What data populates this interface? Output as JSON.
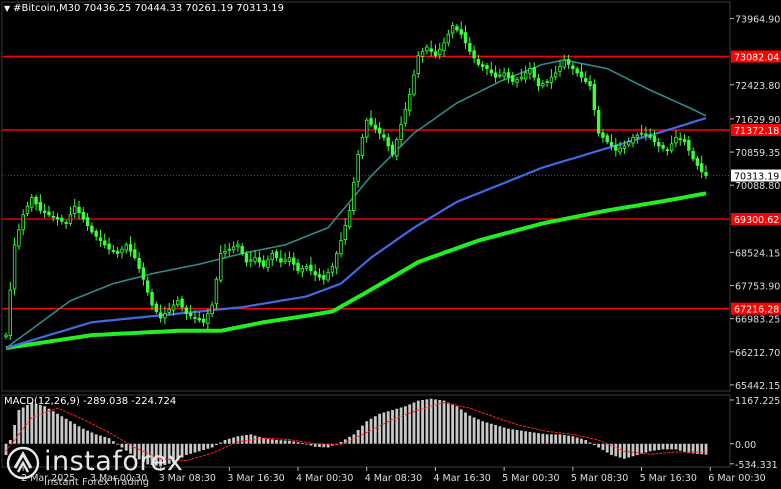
{
  "header": {
    "symbol": "#Bitcoin,M30",
    "open": "70436.25",
    "high": "70444.33",
    "low": "70261.19",
    "close": "70313.19"
  },
  "macd": {
    "label": "MACD(12,26,9)",
    "main": "-289.038",
    "signal": "-224.724"
  },
  "logo": {
    "name": "instaforex",
    "tagline": "Instant Forex Trading"
  },
  "chart_data": {
    "type": "candlestick",
    "symbol": "#Bitcoin",
    "timeframe": "M30",
    "price_axis_ticks": [
      73964.9,
      73082.04,
      72423.8,
      71629.9,
      71372.18,
      70859.35,
      70313.19,
      70088.8,
      69300.62,
      68524.15,
      67753.9,
      67216.28,
      66983.25,
      66212.7,
      65442.15
    ],
    "price_ylim": [
      65300,
      74350
    ],
    "horizontal_levels": [
      {
        "price": 73082.04,
        "label": "73082.04",
        "color": "#ff0000"
      },
      {
        "price": 71372.18,
        "label": "71372.18",
        "color": "#ff0000"
      },
      {
        "price": 69300.62,
        "label": "69300.62",
        "color": "#ff0000"
      },
      {
        "price": 67216.28,
        "label": "67216.28",
        "color": "#ff0000"
      }
    ],
    "current_price": {
      "price": 70313.19,
      "label": "70313.19"
    },
    "time_labels": [
      "2 Mar 2025",
      "3 Mar 00:30",
      "3 Mar 08:30",
      "3 Mar 16:30",
      "4 Mar 00:30",
      "4 Mar 08:30",
      "4 Mar 16:30",
      "5 Mar 00:30",
      "5 Mar 08:30",
      "5 Mar 16:30",
      "6 Mar 00:30"
    ],
    "close_path": [
      [
        0,
        66600
      ],
      [
        2,
        68700
      ],
      [
        4,
        69400
      ],
      [
        6,
        69800
      ],
      [
        8,
        69500
      ],
      [
        10,
        69400
      ],
      [
        12,
        69300
      ],
      [
        14,
        69200
      ],
      [
        16,
        69600
      ],
      [
        18,
        69300
      ],
      [
        20,
        69000
      ],
      [
        22,
        68800
      ],
      [
        24,
        68600
      ],
      [
        26,
        68500
      ],
      [
        28,
        68700
      ],
      [
        30,
        68400
      ],
      [
        32,
        67900
      ],
      [
        34,
        67300
      ],
      [
        36,
        67000
      ],
      [
        38,
        67200
      ],
      [
        40,
        67400
      ],
      [
        42,
        67100
      ],
      [
        44,
        67000
      ],
      [
        46,
        66900
      ],
      [
        48,
        67300
      ],
      [
        50,
        68500
      ],
      [
        52,
        68600
      ],
      [
        54,
        68700
      ],
      [
        56,
        68300
      ],
      [
        58,
        68400
      ],
      [
        60,
        68200
      ],
      [
        62,
        68500
      ],
      [
        64,
        68300
      ],
      [
        66,
        68400
      ],
      [
        68,
        68100
      ],
      [
        70,
        68200
      ],
      [
        72,
        68000
      ],
      [
        74,
        67900
      ],
      [
        76,
        68200
      ],
      [
        78,
        68800
      ],
      [
        80,
        69500
      ],
      [
        82,
        70800
      ],
      [
        84,
        71600
      ],
      [
        86,
        71400
      ],
      [
        88,
        71200
      ],
      [
        90,
        70800
      ],
      [
        92,
        71500
      ],
      [
        94,
        72200
      ],
      [
        96,
        73100
      ],
      [
        98,
        73300
      ],
      [
        100,
        73100
      ],
      [
        102,
        73400
      ],
      [
        104,
        73800
      ],
      [
        106,
        73600
      ],
      [
        108,
        73200
      ],
      [
        110,
        72900
      ],
      [
        112,
        72800
      ],
      [
        114,
        72600
      ],
      [
        116,
        72700
      ],
      [
        118,
        72500
      ],
      [
        120,
        72600
      ],
      [
        122,
        72800
      ],
      [
        124,
        72400
      ],
      [
        126,
        72500
      ],
      [
        128,
        72700
      ],
      [
        130,
        73000
      ],
      [
        132,
        72800
      ],
      [
        134,
        72600
      ],
      [
        136,
        72400
      ],
      [
        138,
        71300
      ],
      [
        140,
        71100
      ],
      [
        142,
        70900
      ],
      [
        144,
        71000
      ],
      [
        146,
        71200
      ],
      [
        148,
        71300
      ],
      [
        150,
        71200
      ],
      [
        152,
        71000
      ],
      [
        154,
        70900
      ],
      [
        156,
        71200
      ],
      [
        158,
        71100
      ],
      [
        160,
        70700
      ],
      [
        162,
        70400
      ],
      [
        163,
        70313
      ]
    ],
    "ma_slow_points": [
      [
        0,
        66300
      ],
      [
        20,
        66600
      ],
      [
        40,
        66700
      ],
      [
        50,
        66700
      ],
      [
        60,
        66900
      ],
      [
        70,
        67050
      ],
      [
        76,
        67150
      ],
      [
        84,
        67600
      ],
      [
        96,
        68300
      ],
      [
        110,
        68800
      ],
      [
        125,
        69200
      ],
      [
        140,
        69500
      ],
      [
        155,
        69750
      ],
      [
        163,
        69900
      ]
    ],
    "ma_fast_points": [
      [
        0,
        66300
      ],
      [
        15,
        67400
      ],
      [
        25,
        67800
      ],
      [
        35,
        68050
      ],
      [
        45,
        68250
      ],
      [
        55,
        68500
      ],
      [
        65,
        68700
      ],
      [
        75,
        69100
      ],
      [
        85,
        70300
      ],
      [
        95,
        71300
      ],
      [
        105,
        72000
      ],
      [
        115,
        72500
      ],
      [
        125,
        72900
      ],
      [
        130,
        73000
      ],
      [
        140,
        72800
      ],
      [
        150,
        72300
      ],
      [
        160,
        71850
      ],
      [
        163,
        71700
      ]
    ],
    "ma_mid_points": [
      [
        0,
        66300
      ],
      [
        20,
        66900
      ],
      [
        40,
        67100
      ],
      [
        55,
        67250
      ],
      [
        70,
        67500
      ],
      [
        78,
        67800
      ],
      [
        85,
        68400
      ],
      [
        95,
        69100
      ],
      [
        105,
        69700
      ],
      [
        115,
        70100
      ],
      [
        125,
        70500
      ],
      [
        135,
        70800
      ],
      [
        145,
        71100
      ],
      [
        155,
        71400
      ],
      [
        163,
        71650
      ]
    ],
    "macd_axis_ticks": [
      1167.225,
      0.0,
      -534.331
    ],
    "macd_ylim": [
      -620,
      1300
    ],
    "macd_hist_path": [
      [
        0,
        -300
      ],
      [
        3,
        900
      ],
      [
        6,
        1100
      ],
      [
        9,
        1000
      ],
      [
        12,
        800
      ],
      [
        15,
        600
      ],
      [
        18,
        400
      ],
      [
        21,
        250
      ],
      [
        24,
        150
      ],
      [
        27,
        -100
      ],
      [
        30,
        -350
      ],
      [
        33,
        -550
      ],
      [
        36,
        -600
      ],
      [
        39,
        -500
      ],
      [
        42,
        -300
      ],
      [
        45,
        -200
      ],
      [
        48,
        -100
      ],
      [
        51,
        100
      ],
      [
        54,
        200
      ],
      [
        57,
        250
      ],
      [
        60,
        150
      ],
      [
        63,
        100
      ],
      [
        66,
        80
      ],
      [
        69,
        20
      ],
      [
        72,
        -80
      ],
      [
        75,
        -100
      ],
      [
        78,
        50
      ],
      [
        81,
        250
      ],
      [
        84,
        600
      ],
      [
        87,
        800
      ],
      [
        90,
        900
      ],
      [
        93,
        1000
      ],
      [
        96,
        1150
      ],
      [
        99,
        1200
      ],
      [
        102,
        1150
      ],
      [
        105,
        1000
      ],
      [
        108,
        750
      ],
      [
        111,
        600
      ],
      [
        114,
        500
      ],
      [
        117,
        400
      ],
      [
        120,
        350
      ],
      [
        123,
        300
      ],
      [
        126,
        250
      ],
      [
        129,
        250
      ],
      [
        132,
        200
      ],
      [
        135,
        100
      ],
      [
        138,
        -100
      ],
      [
        141,
        -300
      ],
      [
        144,
        -400
      ],
      [
        147,
        -300
      ],
      [
        150,
        -200
      ],
      [
        153,
        -150
      ],
      [
        156,
        -150
      ],
      [
        159,
        -250
      ],
      [
        163,
        -289
      ]
    ],
    "macd_signal_path": [
      [
        0,
        -200
      ],
      [
        6,
        700
      ],
      [
        12,
        950
      ],
      [
        18,
        650
      ],
      [
        24,
        300
      ],
      [
        30,
        -100
      ],
      [
        36,
        -400
      ],
      [
        42,
        -450
      ],
      [
        48,
        -250
      ],
      [
        54,
        50
      ],
      [
        60,
        150
      ],
      [
        66,
        110
      ],
      [
        72,
        0
      ],
      [
        78,
        -30
      ],
      [
        84,
        300
      ],
      [
        90,
        650
      ],
      [
        96,
        900
      ],
      [
        102,
        1100
      ],
      [
        108,
        950
      ],
      [
        114,
        700
      ],
      [
        120,
        480
      ],
      [
        126,
        330
      ],
      [
        132,
        250
      ],
      [
        138,
        100
      ],
      [
        144,
        -200
      ],
      [
        150,
        -280
      ],
      [
        156,
        -220
      ],
      [
        163,
        -225
      ]
    ]
  }
}
